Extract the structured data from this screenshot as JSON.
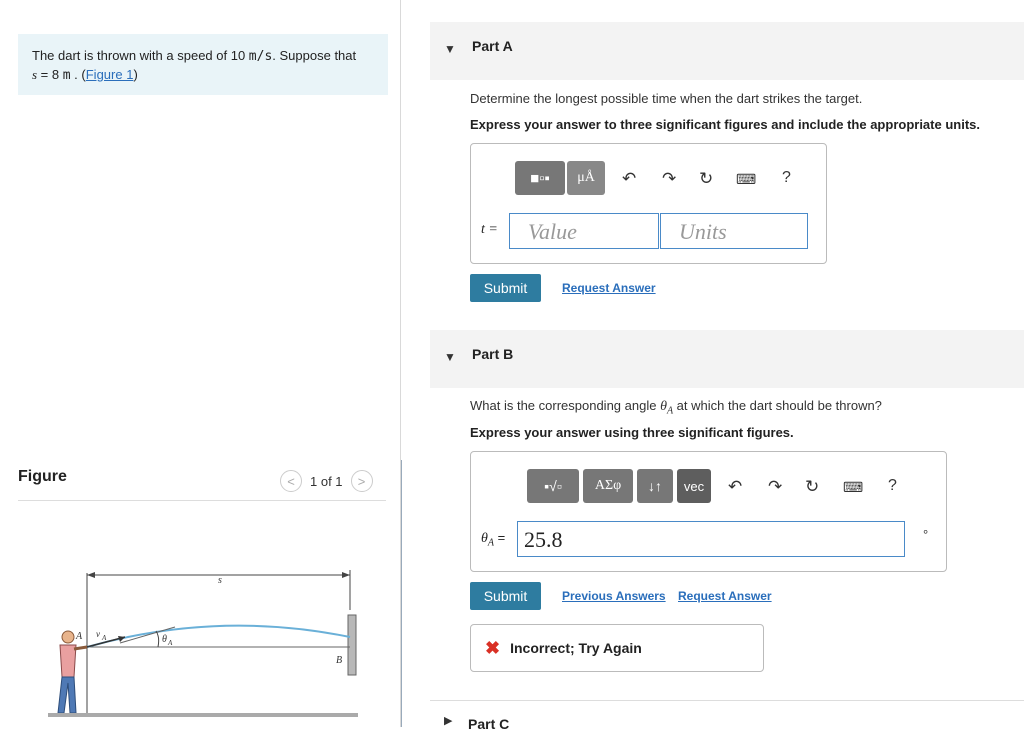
{
  "intro": {
    "text_before": "The dart is thrown with a speed of 10 ",
    "speed_unit": "m/s",
    "text_mid": ". Suppose that",
    "var_s": "s",
    "eq": " = 8  ",
    "unit_m": "m",
    "dot": " . (",
    "figure_link": "Figure 1",
    "close": ")"
  },
  "figure": {
    "title": "Figure",
    "pager": "1 of 1",
    "prev": "<",
    "next": ">",
    "labels": {
      "s": "s",
      "A": "A",
      "vA": "v",
      "vA_sub": "A",
      "theta": "θ",
      "theta_sub": "A",
      "B": "B"
    }
  },
  "partA": {
    "label": "Part A",
    "question": "Determine the longest possible time when the dart strikes the target.",
    "instruction": "Express your answer to three significant figures and include the appropriate units.",
    "var_label": "t =",
    "value_placeholder": "Value",
    "units_placeholder": "Units",
    "tool_units": "μÅ",
    "help": "?",
    "submit": "Submit",
    "request": "Request Answer"
  },
  "partB": {
    "label": "Part B",
    "question_before": "What is the corresponding angle ",
    "theta": "θ",
    "theta_sub": "A",
    "question_after": " at which the dart should be thrown?",
    "instruction": "Express your answer using three significant figures.",
    "var_label": "θ",
    "var_sub": "A",
    "eq": " =",
    "value": "25.8",
    "degree": "°",
    "tool_greek": "ΑΣφ",
    "tool_arrows": "↓↑",
    "tool_vec": "vec",
    "help": "?",
    "submit": "Submit",
    "previous": "Previous Answers",
    "request": "Request Answer",
    "feedback": "Incorrect; Try Again"
  },
  "partC": {
    "label": "Part C"
  },
  "colors": {
    "accent": "#2e7ca0",
    "link": "#2a6ebb",
    "error": "#d93025",
    "intro_bg": "#e9f4f8"
  },
  "icons": [
    "undo-icon",
    "redo-icon",
    "reset-icon",
    "keyboard-icon",
    "help-icon",
    "template-icon",
    "sqrt-icon",
    "close-x-icon",
    "caret-down-icon",
    "caret-right-icon"
  ]
}
